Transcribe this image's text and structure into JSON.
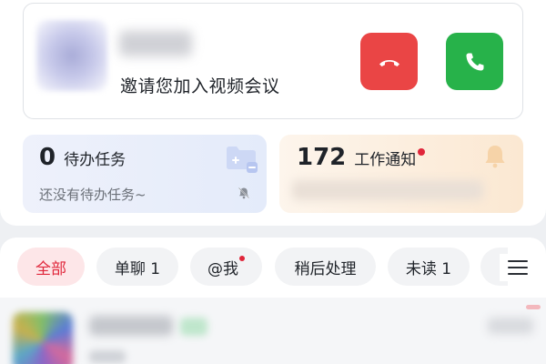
{
  "call_invite": {
    "message": "邀请您加入视频会议",
    "decline_icon": "phone-hangup-icon",
    "accept_icon": "phone-answer-icon"
  },
  "tasks": {
    "count": "0",
    "label": "待办任务",
    "empty_text": "还没有待办任务~"
  },
  "notifications": {
    "count": "172",
    "label": "工作通知",
    "has_unread": true
  },
  "filters": [
    {
      "label": "全部",
      "active": true
    },
    {
      "label": "单聊 1",
      "active": false
    },
    {
      "label": "@我",
      "active": false,
      "dot": true
    },
    {
      "label": "稍后处理",
      "active": false
    },
    {
      "label": "未读 1",
      "active": false
    }
  ],
  "colors": {
    "decline": "#ea4545",
    "accept": "#27b24a",
    "accent_red": "#e0263a",
    "active_chip_bg": "#fde6e8"
  }
}
